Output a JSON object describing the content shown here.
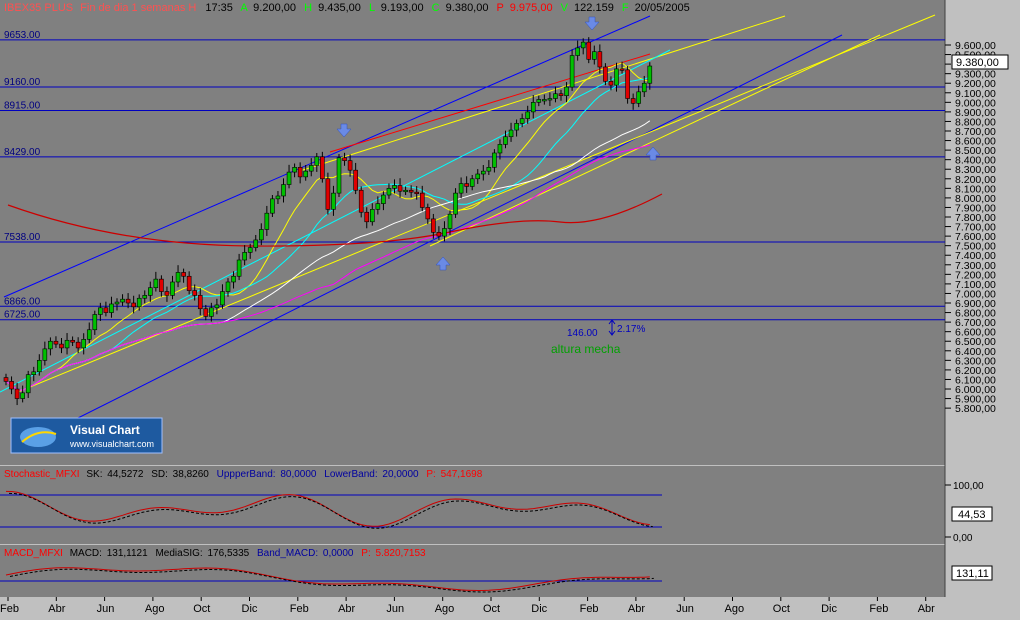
{
  "header": {
    "symbol": "IBEX35 PLUS",
    "period": "Fin de dia 1 semanas H",
    "time": "17:35",
    "a_label": "A",
    "a_value": "9.200,00",
    "h_label": "H",
    "h_value": "9.435,00",
    "l_label": "L",
    "l_value": "9.193,00",
    "c_label": "C",
    "c_value": "9.380,00",
    "p_label": "P",
    "p_value": "9.975,00",
    "v_label": "V",
    "v_value": "122.159",
    "f_label": "F",
    "f_value": "20/05/2005"
  },
  "levels": [
    {
      "value": 9653,
      "label": "9653.00"
    },
    {
      "value": 9160,
      "label": "9160.00"
    },
    {
      "value": 8915,
      "label": "8915.00"
    },
    {
      "value": 8429,
      "label": "8429.00"
    },
    {
      "value": 7538,
      "label": "7538.00"
    },
    {
      "value": 6866,
      "label": "6866.00"
    },
    {
      "value": 6725,
      "label": "6725.00"
    }
  ],
  "price_axis": {
    "ticks": [
      "9.600,00",
      "9.500,00",
      "9.400,00",
      "9.300,00",
      "9.200,00",
      "9.100,00",
      "9.000,00",
      "8.900,00",
      "8.800,00",
      "8.700,00",
      "8.600,00",
      "8.500,00",
      "8.400,00",
      "8.300,00",
      "8.200,00",
      "8.100,00",
      "8.000,00",
      "7.900,00",
      "7.800,00",
      "7.700,00",
      "7.600,00",
      "7.500,00",
      "7.400,00",
      "7.300,00",
      "7.200,00",
      "7.100,00",
      "7.000,00",
      "6.900,00",
      "6.800,00",
      "6.700,00",
      "6.600,00",
      "6.500,00",
      "6.400,00",
      "6.300,00",
      "6.200,00",
      "6.100,00",
      "6.000,00",
      "5.900,00",
      "5.800,00"
    ],
    "current_label": "9.380,00"
  },
  "annotations": {
    "mecha_points": "146.00",
    "mecha_percent": "2.17%",
    "mecha_text": "altura mecha"
  },
  "logo": {
    "name": "Visual Chart",
    "url": "www.visualchart.com"
  },
  "stochastic": {
    "title": "Stochastic_MFXI",
    "sk_label": "SK:",
    "sk_value": "44,5272",
    "sd_label": "SD:",
    "sd_value": "38,8260",
    "upper_label": "UppperBand:",
    "upper_value": "80,0000",
    "lower_label": "LowerBand:",
    "lower_value": "20,0000",
    "p_label": "P:",
    "p_value": "547,1698",
    "axis_ticks": [
      "100,00",
      "0,00"
    ],
    "current_label": "44,53"
  },
  "macd": {
    "title": "MACD_MFXI",
    "macd_label": "MACD:",
    "macd_value": "131,1121",
    "sig_label": "MediaSIG:",
    "sig_value": "176,5335",
    "band_label": "Band_MACD:",
    "band_value": "0,0000",
    "p_label": "P:",
    "p_value": "5.820,7153",
    "current_label": "131,11"
  },
  "time_axis": [
    "Feb",
    "Abr",
    "Jun",
    "Ago",
    "Oct",
    "Dic",
    "Feb",
    "Abr",
    "Jun",
    "Ago",
    "Oct",
    "Dic",
    "Feb",
    "Abr",
    "Jun",
    "Ago",
    "Oct",
    "Dic",
    "Feb",
    "Abr"
  ],
  "colors": {
    "up": "#00c000",
    "down": "#e00000",
    "level": "#0000c0",
    "channel_blue": "#0000ff",
    "channel_yellow": "#ffff00"
  },
  "chart_data": {
    "type": "candlestick",
    "weekly_closes": [
      6080,
      6000,
      5900,
      5960,
      6150,
      6180,
      6300,
      6420,
      6500,
      6470,
      6430,
      6510,
      6490,
      6430,
      6520,
      6620,
      6780,
      6850,
      6800,
      6890,
      6910,
      6940,
      6900,
      6860,
      6950,
      6980,
      7060,
      7150,
      7020,
      6980,
      7120,
      7220,
      7180,
      7030,
      6980,
      6840,
      6760,
      6850,
      6880,
      7020,
      7120,
      7180,
      7350,
      7430,
      7480,
      7560,
      7670,
      7840,
      7990,
      8020,
      8140,
      8270,
      8320,
      8220,
      8280,
      8340,
      8430,
      8200,
      7880,
      8050,
      8420,
      8390,
      8290,
      8080,
      7850,
      7750,
      7880,
      7940,
      8030,
      8100,
      8130,
      8070,
      8080,
      8060,
      8050,
      7900,
      7780,
      7640,
      7600,
      7680,
      7830,
      8050,
      8150,
      8120,
      8200,
      8250,
      8280,
      8320,
      8470,
      8560,
      8640,
      8710,
      8780,
      8830,
      8900,
      9000,
      9030,
      9030,
      9040,
      9090,
      9070,
      9160,
      9490,
      9570,
      9630,
      9450,
      9530,
      9370,
      9220,
      9180,
      9350,
      9340,
      9040,
      8990,
      9110,
      9200,
      9380
    ],
    "stochastic_sk_last": 44.5272,
    "stochastic_sd_last": 38.826,
    "stochastic_bands": [
      20,
      80
    ],
    "macd_last": 131.1121,
    "macd_signal_last": 176.5335
  }
}
